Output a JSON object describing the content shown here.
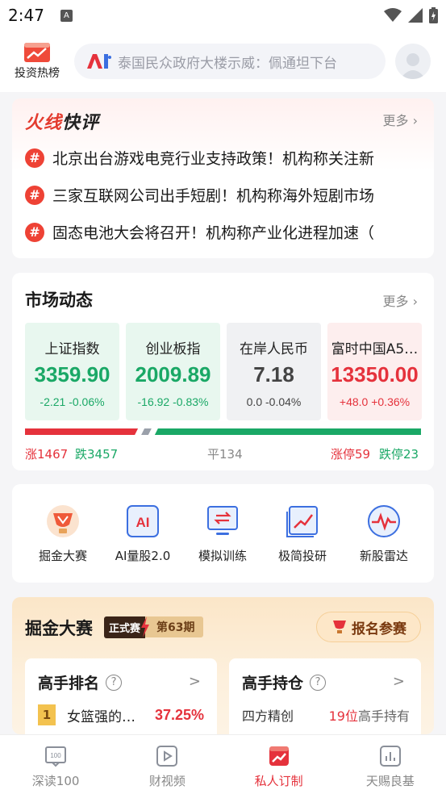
{
  "status_bar": {
    "time": "2:47",
    "notification_icon": "A"
  },
  "top_bar": {
    "hot_label": "投资热榜",
    "search_placeholder": "泰国民众政府大楼示威：佩通坦下台",
    "search_logo_text": "AI"
  },
  "hot_comments": {
    "title_part1": "火线",
    "title_part2": "快评",
    "more": "更多",
    "hash_symbol": "#",
    "items": [
      "北京出台游戏电竞行业支持政策！机构称关注新",
      "三家互联网公司出手短剧！机构称海外短剧市场",
      "固态电池大会将召开！机构称产业化进程加速（"
    ]
  },
  "market": {
    "title": "市场动态",
    "more": "更多",
    "indices": [
      {
        "name": "上证指数",
        "value": "3359.90",
        "change": "-2.21",
        "pct": "-0.06%",
        "tone": "green"
      },
      {
        "name": "创业板指",
        "value": "2009.89",
        "change": "-16.92",
        "pct": "-0.83%",
        "tone": "green"
      },
      {
        "name": "在岸人民币",
        "value": "7.18",
        "change": "0.0",
        "pct": "-0.04%",
        "tone": "gray"
      },
      {
        "name": "富时中国A5…",
        "value": "13350.00",
        "change": "+48.0",
        "pct": "+0.36%",
        "tone": "red"
      }
    ],
    "breadth": {
      "up_label": "涨1467",
      "down_label": "跌3457",
      "flat_label": "平134",
      "limit_up_label": "涨停59",
      "limit_down_label": "跌停23",
      "up_count": 1467,
      "down_count": 3457,
      "flat_count": 134,
      "colors": {
        "up": "#e5323c",
        "down": "#1aa866",
        "flat": "#9aa0aa"
      }
    }
  },
  "tools": [
    {
      "label": "掘金大赛",
      "icon": "trophy-icon"
    },
    {
      "label": "AI量股2.0",
      "icon": "ai-icon"
    },
    {
      "label": "模拟训练",
      "icon": "exchange-screen-icon"
    },
    {
      "label": "极简投研",
      "icon": "trend-chart-icon"
    },
    {
      "label": "新股雷达",
      "icon": "radar-icon"
    }
  ],
  "contest": {
    "title": "掘金大赛",
    "badge_type": "正式赛",
    "badge_period": "第63期",
    "signup_button": "报名参赛",
    "ranking": {
      "title": "高手排名",
      "rank": "1",
      "name": "女篮强的…",
      "return": "37.25%"
    },
    "holdings": {
      "title": "高手持仓",
      "stock": "四方精创",
      "rank_text": "19位",
      "suffix": "高手持有"
    },
    "help_symbol": "?",
    "arrow_symbol": ">"
  },
  "bottom_nav": [
    {
      "label": "深读100",
      "icon": "news-100-icon",
      "active": false
    },
    {
      "label": "财视频",
      "icon": "play-video-icon",
      "active": false
    },
    {
      "label": "私人订制",
      "icon": "custom-trend-icon",
      "active": true
    },
    {
      "label": "天赐良基",
      "icon": "fund-chart-icon",
      "active": false
    }
  ],
  "colors": {
    "accent_red": "#e5323c",
    "accent_green": "#1aa866",
    "brand_fire": "#e33b2e"
  }
}
